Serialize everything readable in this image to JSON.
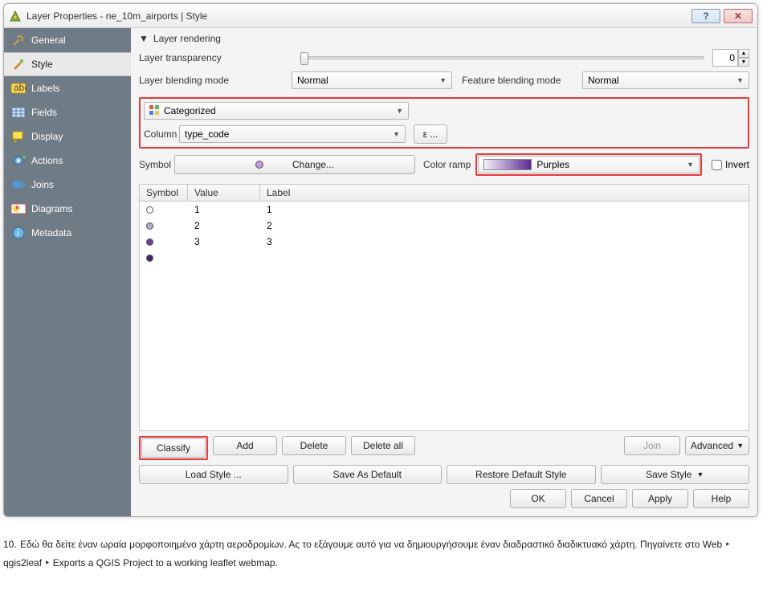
{
  "window": {
    "title": "Layer Properties - ne_10m_airports | Style"
  },
  "sidebar": {
    "items": [
      {
        "label": "General"
      },
      {
        "label": "Style"
      },
      {
        "label": "Labels"
      },
      {
        "label": "Fields"
      },
      {
        "label": "Display"
      },
      {
        "label": "Actions"
      },
      {
        "label": "Joins"
      },
      {
        "label": "Diagrams"
      },
      {
        "label": "Metadata"
      }
    ]
  },
  "rendering": {
    "section_title": "Layer rendering",
    "transparency_label": "Layer transparency",
    "transparency_value": "0",
    "layer_blend_label": "Layer blending mode",
    "layer_blend_value": "Normal",
    "feature_blend_label": "Feature blending mode",
    "feature_blend_value": "Normal"
  },
  "classify": {
    "style_type": "Categorized",
    "column_label": "Column",
    "column_value": "type_code",
    "epsilon_label": "ε ...",
    "symbol_label": "Symbol",
    "change_label": "Change...",
    "colorramp_label": "Color ramp",
    "colorramp_value": "Purples",
    "invert_label": "Invert"
  },
  "table": {
    "headers": {
      "symbol": "Symbol",
      "value": "Value",
      "label": "Label"
    },
    "rows": [
      {
        "value": "1",
        "label": "1",
        "fill": "#ffffff"
      },
      {
        "value": "2",
        "label": "2",
        "fill": "#b9a6cf"
      },
      {
        "value": "3",
        "label": "3",
        "fill": "#6b3fa0"
      },
      {
        "value": "",
        "label": "",
        "fill": "#4a2270"
      }
    ]
  },
  "buttons": {
    "classify": "Classify",
    "add": "Add",
    "delete": "Delete",
    "delete_all": "Delete all",
    "join": "Join",
    "advanced": "Advanced",
    "load_style": "Load Style ...",
    "save_default": "Save As Default",
    "restore_default": "Restore Default Style",
    "save_style": "Save Style",
    "ok": "OK",
    "cancel": "Cancel",
    "apply": "Apply",
    "help": "Help"
  },
  "caption": {
    "num": "10.",
    "text1": "Εδώ θα δείτε έναν ωραία μορφοποιημένο χάρτη αεροδρομίων. Ας το εξάγουμε αυτό για να δημιουργήσουμε έναν διαδραστικό διαδικτυακό χάρτη. Πηγαίνετε στο Web ‣ qgis2leaf ‣ Exports a QGIS Project to a working leaflet webmap."
  }
}
